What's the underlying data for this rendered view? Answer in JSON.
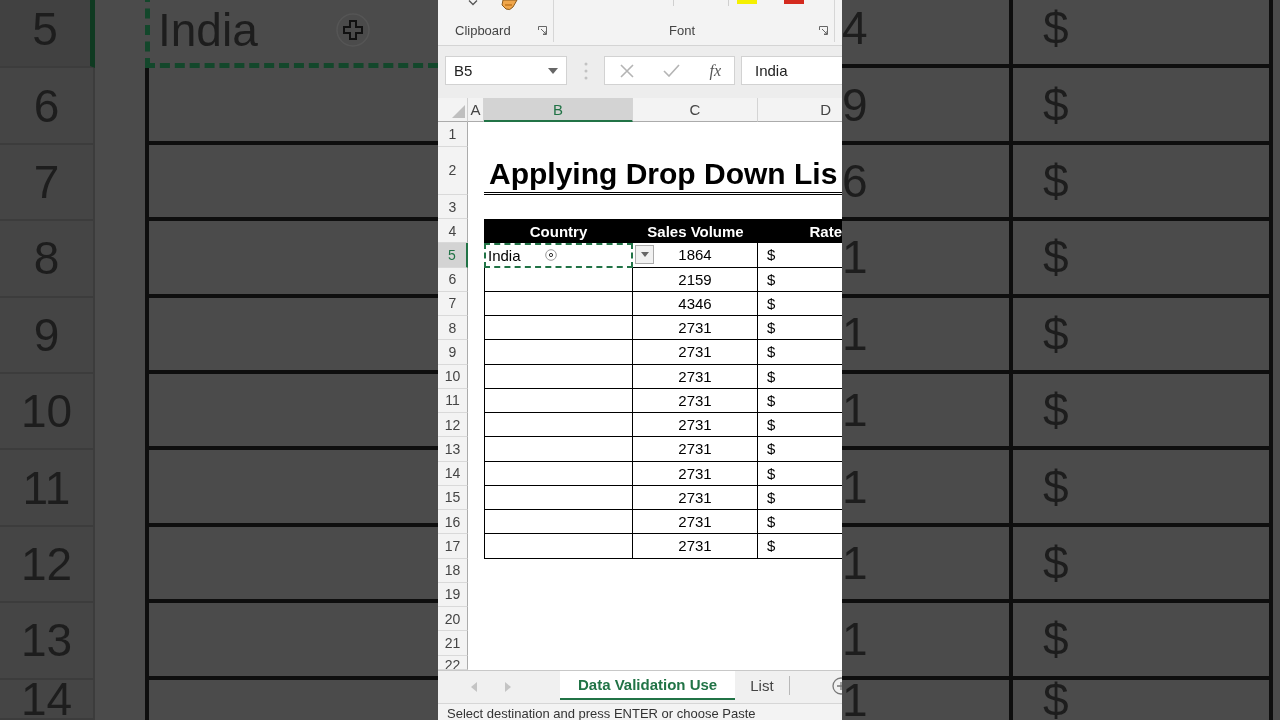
{
  "backdrop_left": {
    "rows": [
      {
        "number": "5",
        "selected": true,
        "value": "India"
      },
      {
        "number": "6",
        "selected": false
      },
      {
        "number": "7",
        "selected": false
      },
      {
        "number": "8",
        "selected": false
      },
      {
        "number": "9",
        "selected": false
      },
      {
        "number": "10",
        "selected": false
      },
      {
        "number": "11",
        "selected": false
      },
      {
        "number": "12",
        "selected": false
      },
      {
        "number": "13",
        "selected": false
      },
      {
        "number": "14",
        "selected": false
      }
    ]
  },
  "ribbon": {
    "groups": [
      {
        "label": "Clipboard"
      },
      {
        "label": "Font"
      }
    ]
  },
  "formula_bar": {
    "name_box": "B5",
    "function_label": "fx",
    "value": "India"
  },
  "sheet": {
    "columns": [
      {
        "label": "A",
        "selected": false
      },
      {
        "label": "B",
        "selected": true
      },
      {
        "label": "C",
        "selected": false
      },
      {
        "label": "D",
        "selected": false
      }
    ],
    "row_headers": [
      {
        "label": "1",
        "selected": false
      },
      {
        "label": "2",
        "selected": false
      },
      {
        "label": "3",
        "selected": false
      },
      {
        "label": "4",
        "selected": false
      },
      {
        "label": "5",
        "selected": true
      },
      {
        "label": "6",
        "selected": false
      },
      {
        "label": "7",
        "selected": false
      },
      {
        "label": "8",
        "selected": false
      },
      {
        "label": "9",
        "selected": false
      },
      {
        "label": "10",
        "selected": false
      },
      {
        "label": "11",
        "selected": false
      },
      {
        "label": "12",
        "selected": false
      },
      {
        "label": "13",
        "selected": false
      },
      {
        "label": "14",
        "selected": false
      },
      {
        "label": "15",
        "selected": false
      },
      {
        "label": "16",
        "selected": false
      },
      {
        "label": "17",
        "selected": false
      },
      {
        "label": "18",
        "selected": false
      },
      {
        "label": "19",
        "selected": false
      },
      {
        "label": "20",
        "selected": false
      },
      {
        "label": "21",
        "selected": false
      },
      {
        "label": "22",
        "selected": false
      }
    ],
    "title": "Applying Drop Down Lis",
    "table": {
      "headers": [
        "Country",
        "Sales Volume",
        "Rate"
      ],
      "rows": [
        {
          "country": "India",
          "sales_volume": "1864",
          "rate": "$",
          "selected": true
        },
        {
          "sales_volume": "2159",
          "rate": "$",
          "selected": false
        },
        {
          "sales_volume": "4346",
          "rate": "$",
          "selected": false
        },
        {
          "sales_volume": "2731",
          "rate": "$",
          "selected": false
        },
        {
          "sales_volume": "2731",
          "rate": "$",
          "selected": false
        },
        {
          "sales_volume": "2731",
          "rate": "$",
          "selected": false
        },
        {
          "sales_volume": "2731",
          "rate": "$",
          "selected": false
        },
        {
          "sales_volume": "2731",
          "rate": "$",
          "selected": false
        },
        {
          "sales_volume": "2731",
          "rate": "$",
          "selected": false
        },
        {
          "sales_volume": "2731",
          "rate": "$",
          "selected": false
        },
        {
          "sales_volume": "2731",
          "rate": "$",
          "selected": false
        },
        {
          "sales_volume": "2731",
          "rate": "$",
          "selected": false
        },
        {
          "sales_volume": "2731",
          "rate": "$",
          "selected": false
        }
      ]
    }
  },
  "sheet_tabs": [
    {
      "label": "Data Validation Use",
      "selected": true
    },
    {
      "label": "List",
      "selected": false
    }
  ],
  "status_bar": "Select destination and press ENTER or choose Paste",
  "backdrop_right": {
    "rows": [
      {
        "column_1": "4",
        "column_2": "$"
      },
      {
        "column_1": "9",
        "column_2": "$"
      },
      {
        "column_1": "6",
        "column_2": "$"
      },
      {
        "column_1": "1",
        "column_2": "$"
      },
      {
        "column_1": "1",
        "column_2": "$"
      },
      {
        "column_1": "1",
        "column_2": "$"
      },
      {
        "column_1": "1",
        "column_2": "$"
      },
      {
        "column_1": "1",
        "column_2": "$"
      },
      {
        "column_1": "1",
        "column_2": "$"
      },
      {
        "column_1": "1",
        "column_2": "$"
      }
    ]
  }
}
